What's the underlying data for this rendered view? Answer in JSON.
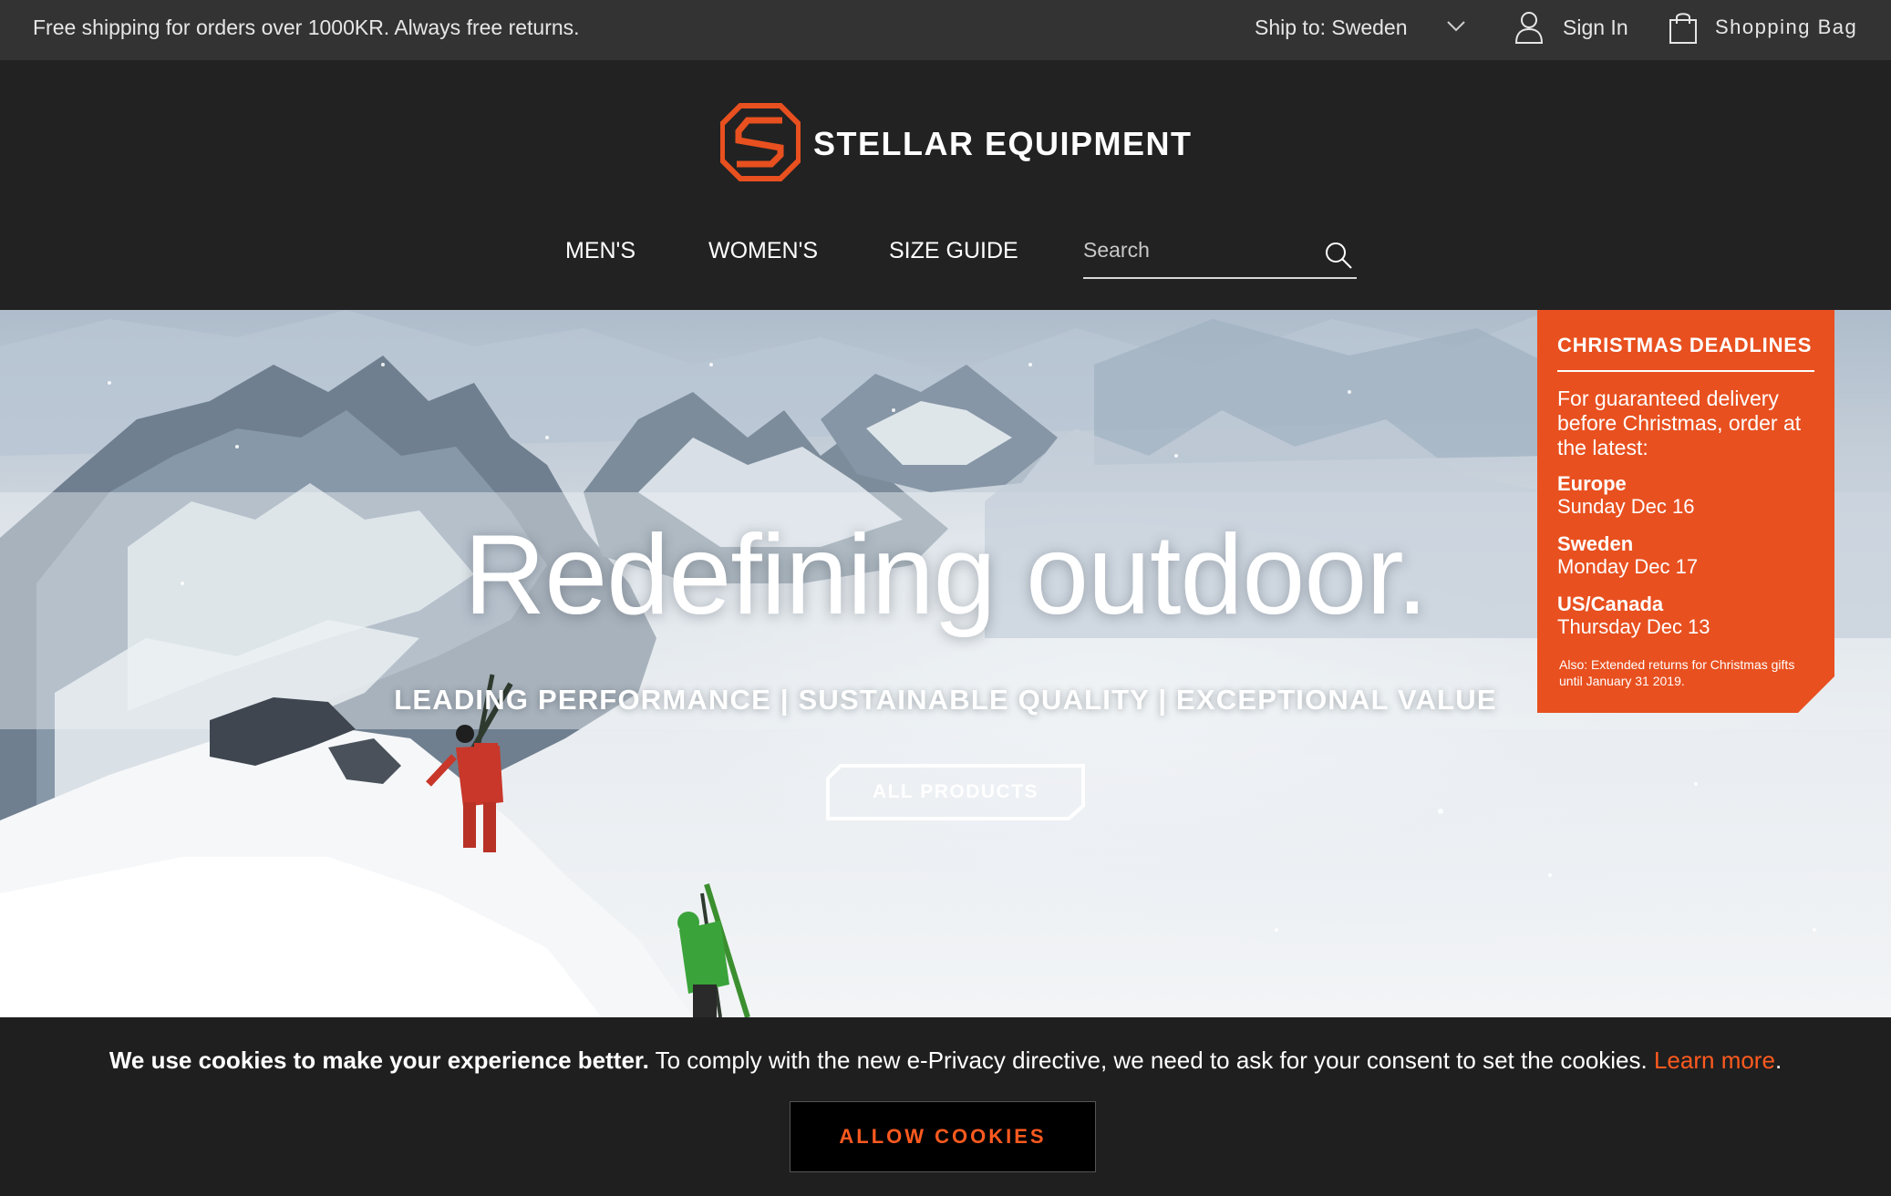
{
  "topbar": {
    "promo": "Free shipping for orders over 1000KR. Always free returns.",
    "ship_to": "Ship to: Sweden",
    "sign_in": "Sign In",
    "shopping_bag": "Shopping Bag"
  },
  "header": {
    "brand": "STELLAR EQUIPMENT",
    "nav": {
      "mens": "MEN'S",
      "womens": "WOMEN'S",
      "size_guide": "SIZE GUIDE"
    },
    "search_placeholder": "Search"
  },
  "hero": {
    "title": "Redefining outdoor.",
    "subtitle": "LEADING PERFORMANCE | SUSTAINABLE QUALITY | EXCEPTIONAL VALUE",
    "button": "ALL PRODUCTS"
  },
  "christmas": {
    "title": "CHRISTMAS DEADLINES",
    "intro": "For guaranteed delivery before Christmas, order at the latest:",
    "regions": [
      {
        "name": "Europe",
        "date": "Sunday Dec 16"
      },
      {
        "name": "Sweden",
        "date": "Monday Dec 17"
      },
      {
        "name": "US/Canada",
        "date": "Thursday Dec 13"
      }
    ],
    "note": "Also: Extended returns for Christmas gifts until January 31 2019."
  },
  "cookie": {
    "bold": "We use cookies to make your experience better.",
    "text": " To comply with the new e-Privacy directive, we need to ask for your consent to set the cookies. ",
    "learn_more": "Learn more",
    "period": ".",
    "button": "ALLOW COOKIES"
  },
  "colors": {
    "accent": "#e8501f",
    "cookie_accent": "#ff5a1f",
    "topbar": "#333333",
    "header": "#222222"
  }
}
